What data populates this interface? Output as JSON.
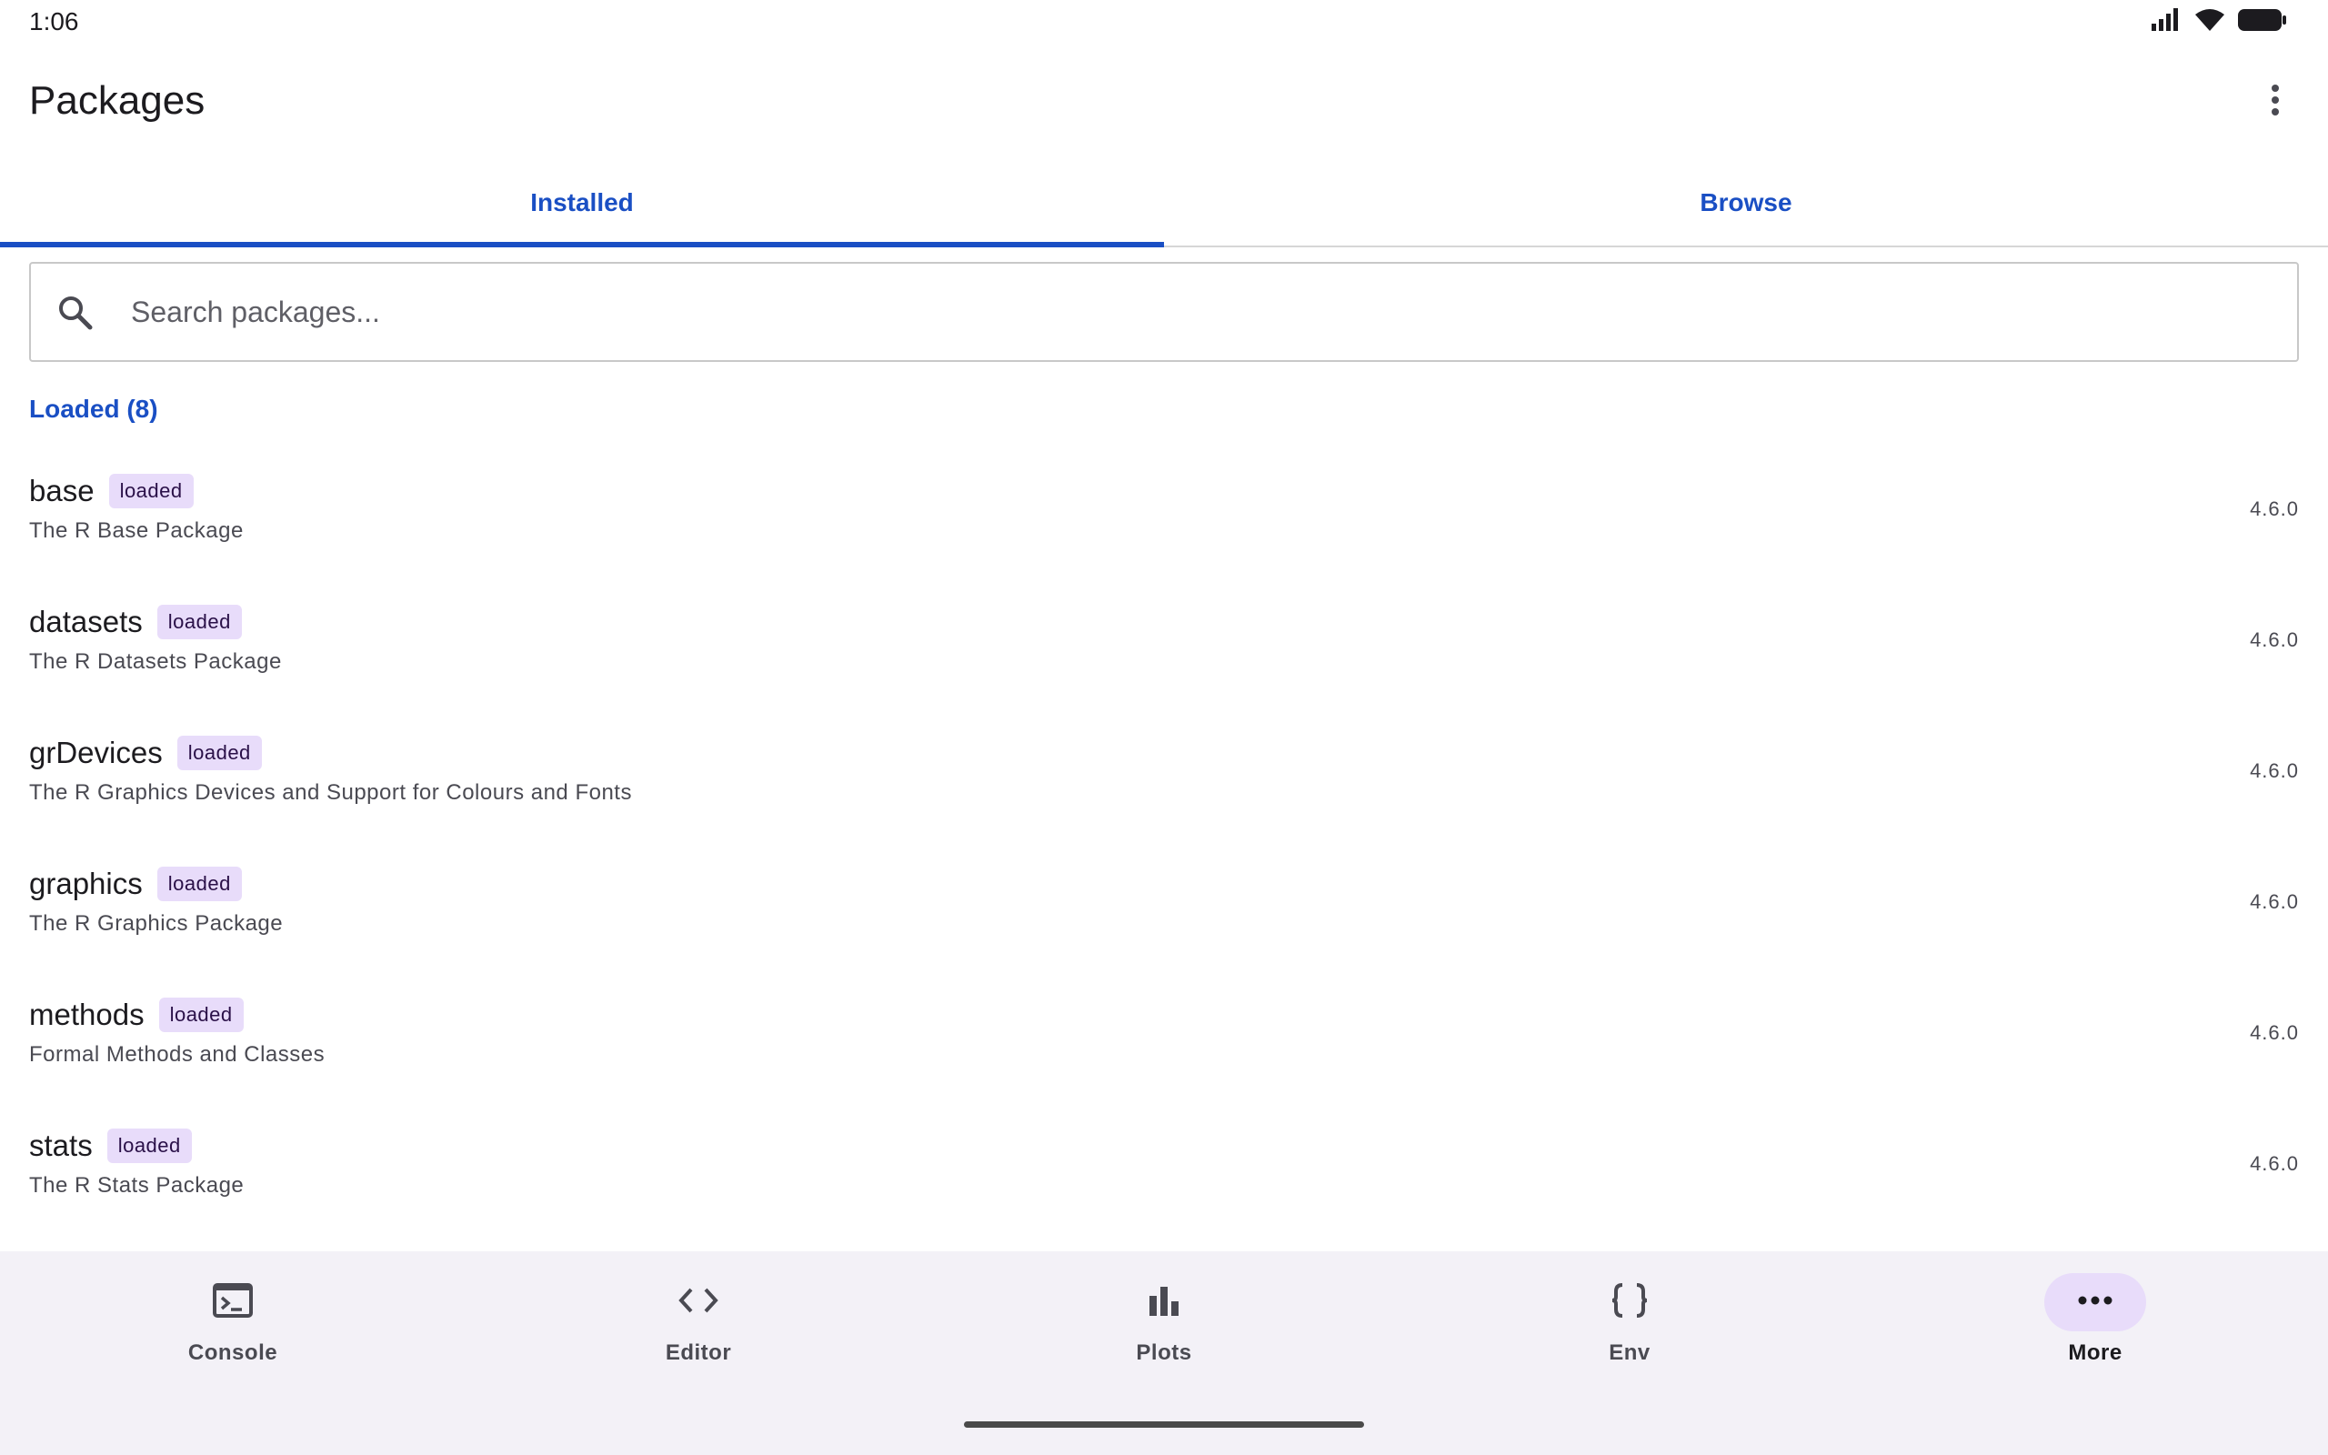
{
  "status_bar": {
    "time": "1:06",
    "icons": [
      "signal-icon",
      "wifi-icon",
      "battery-icon"
    ]
  },
  "app_bar": {
    "title": "Packages",
    "overflow_icon": "more-vert-icon"
  },
  "tabs": [
    {
      "label": "Installed",
      "active": true
    },
    {
      "label": "Browse",
      "active": false
    }
  ],
  "search": {
    "placeholder": "Search packages...",
    "value": "",
    "icon": "search-icon"
  },
  "section": {
    "label": "Loaded (8)"
  },
  "packages": [
    {
      "name": "base",
      "badge": "loaded",
      "description": "The R Base Package",
      "version": "4.6.0"
    },
    {
      "name": "datasets",
      "badge": "loaded",
      "description": "The R Datasets Package",
      "version": "4.6.0"
    },
    {
      "name": "grDevices",
      "badge": "loaded",
      "description": "The R Graphics Devices and Support for Colours and Fonts",
      "version": "4.6.0"
    },
    {
      "name": "graphics",
      "badge": "loaded",
      "description": "The R Graphics Package",
      "version": "4.6.0"
    },
    {
      "name": "methods",
      "badge": "loaded",
      "description": "Formal Methods and Classes",
      "version": "4.6.0"
    },
    {
      "name": "stats",
      "badge": "loaded",
      "description": "The R Stats Package",
      "version": "4.6.0"
    }
  ],
  "bottom_nav": [
    {
      "label": "Console",
      "icon": "terminal-icon",
      "active": false
    },
    {
      "label": "Editor",
      "icon": "code-icon",
      "active": false
    },
    {
      "label": "Plots",
      "icon": "bar-chart-icon",
      "active": false
    },
    {
      "label": "Env",
      "icon": "braces-icon",
      "active": false
    },
    {
      "label": "More",
      "icon": "more-horiz-icon",
      "active": true
    }
  ],
  "colors": {
    "accent": "#1a4fc4",
    "badge_bg": "#e8dcfa",
    "nav_bg": "#f3f1f7"
  }
}
